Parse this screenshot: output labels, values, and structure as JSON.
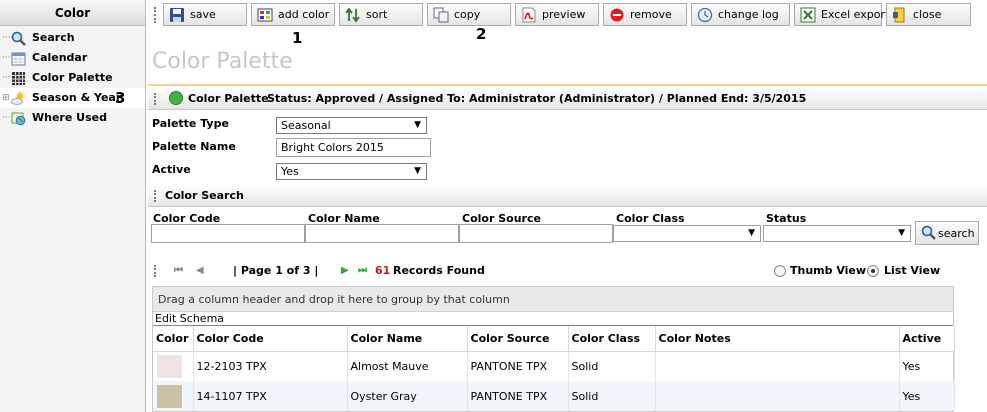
{
  "sidebar": {
    "title": "Color",
    "items": [
      {
        "label": "Search",
        "icon": "magnifier-icon"
      },
      {
        "label": "Calendar",
        "icon": "calendar-icon"
      },
      {
        "label": "Color Palette",
        "icon": "grid-icon"
      },
      {
        "label": "Season & Year",
        "icon": "sun-cloud-icon"
      },
      {
        "label": "Where Used",
        "icon": "globe-icon"
      }
    ],
    "annotation": "3"
  },
  "toolbar": {
    "buttons": [
      {
        "label": "save",
        "icon": "floppy-disk-icon"
      },
      {
        "label": "add color",
        "icon": "add-color-icon"
      },
      {
        "label": "sort",
        "icon": "sort-arrows-icon"
      },
      {
        "label": "copy",
        "icon": "copy-icon"
      },
      {
        "label": "preview",
        "icon": "pdf-icon"
      },
      {
        "label": "remove",
        "icon": "remove-icon"
      },
      {
        "label": "change log",
        "icon": "change-log-icon"
      },
      {
        "label": "Excel export",
        "icon": "excel-icon"
      },
      {
        "label": "close",
        "icon": "close-door-icon"
      }
    ],
    "annotation_1": "1",
    "annotation_2": "2"
  },
  "page": {
    "title": "Color Palette"
  },
  "header_band": {
    "name": "Color Palette",
    "details": "Status: Approved / Assigned To: Administrator (Administrator) / Planned End: 3/5/2015",
    "status_color": "#3fb23f"
  },
  "form": {
    "palette_type_label": "Palette Type",
    "palette_type_value": "Seasonal",
    "palette_name_label": "Palette Name",
    "palette_name_value": "Bright Colors 2015",
    "active_label": "Active",
    "active_value": "Yes"
  },
  "color_search": {
    "title": "Color Search",
    "fields": [
      "Color Code",
      "Color Name",
      "Color Source",
      "Color Class",
      "Status"
    ],
    "search_button": "search"
  },
  "pager": {
    "page_text": "| Page 1 of 3 |",
    "records_count": "61",
    "records_label": "Records Found",
    "thumb_view": "Thumb View",
    "list_view": "List View",
    "selected_view": "List View"
  },
  "grid": {
    "group_hint": "Drag a column header and drop it here to group by that column",
    "edit_schema": "Edit Schema",
    "columns": [
      "Color",
      "Color Code",
      "Color Name",
      "Color Source",
      "Color Class",
      "Color Notes",
      "Active"
    ],
    "rows": [
      {
        "swatch": "#efe3e3",
        "code": "12-2103 TPX",
        "name": "Almost Mauve",
        "source": "PANTONE TPX",
        "class": "Solid",
        "notes": "",
        "active": "Yes"
      },
      {
        "swatch": "#cbbfa6",
        "code": "14-1107 TPX",
        "name": "Oyster Gray",
        "source": "PANTONE TPX",
        "class": "Solid",
        "notes": "",
        "active": "Yes"
      }
    ]
  }
}
